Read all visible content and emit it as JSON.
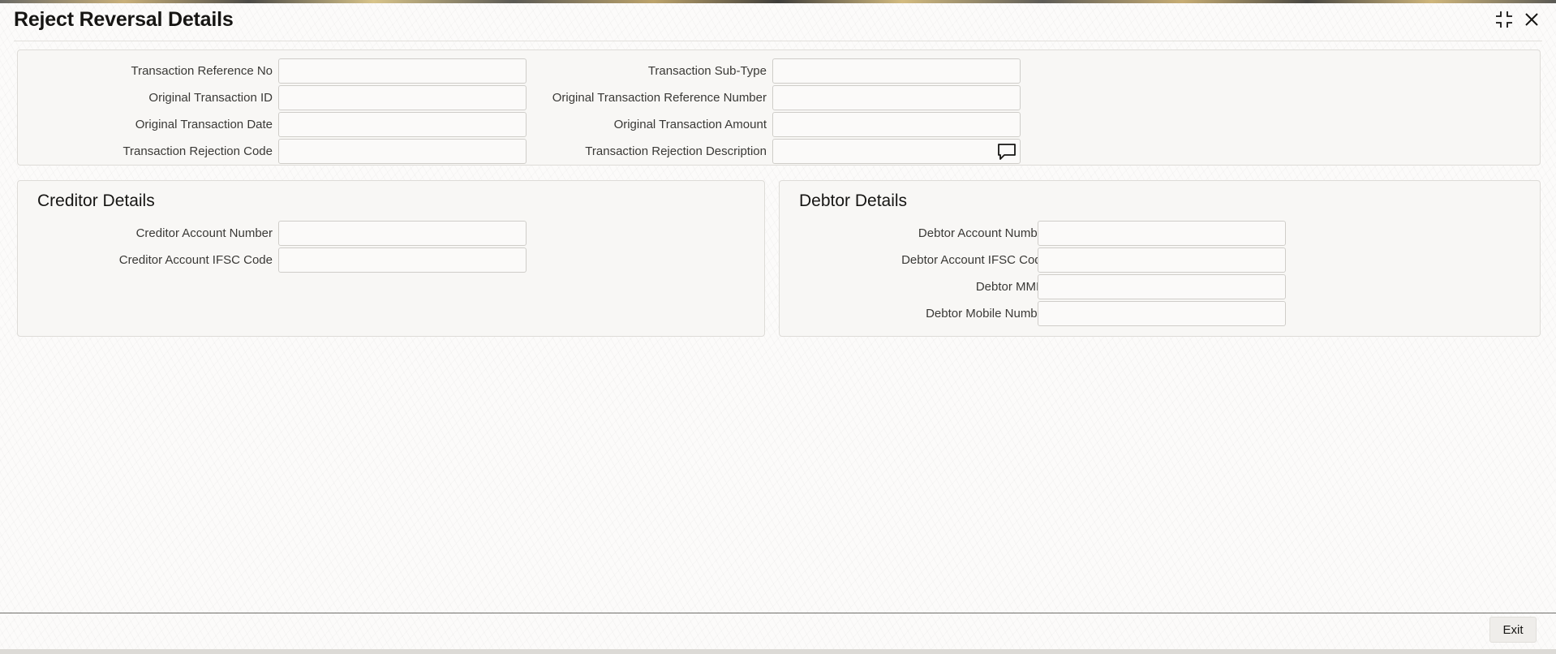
{
  "window": {
    "title": "Reject Reversal Details",
    "maximize_icon": "maximize-icon",
    "close_icon": "close-icon"
  },
  "main": {
    "left_fields": [
      {
        "label": "Transaction Reference No",
        "value": ""
      },
      {
        "label": "Original Transaction ID",
        "value": ""
      },
      {
        "label": "Original Transaction Date",
        "value": ""
      },
      {
        "label": "Transaction Rejection Code",
        "value": ""
      }
    ],
    "right_fields": [
      {
        "label": "Transaction Sub-Type",
        "value": ""
      },
      {
        "label": "Original Transaction Reference Number",
        "value": ""
      },
      {
        "label": "Original Transaction Amount",
        "value": ""
      },
      {
        "label": "Transaction Rejection Description",
        "value": "",
        "icon": "comment-icon"
      }
    ]
  },
  "creditor": {
    "title": "Creditor Details",
    "fields": [
      {
        "label": "Creditor Account Number",
        "value": ""
      },
      {
        "label": "Creditor Account IFSC Code",
        "value": ""
      }
    ]
  },
  "debtor": {
    "title": "Debtor Details",
    "fields": [
      {
        "label": "Debtor Account Number",
        "value": ""
      },
      {
        "label": "Debtor Account IFSC Code",
        "value": ""
      },
      {
        "label": "Debtor MMID",
        "value": ""
      },
      {
        "label": "Debtor Mobile Number",
        "value": ""
      }
    ]
  },
  "footer": {
    "exit_label": "Exit"
  }
}
